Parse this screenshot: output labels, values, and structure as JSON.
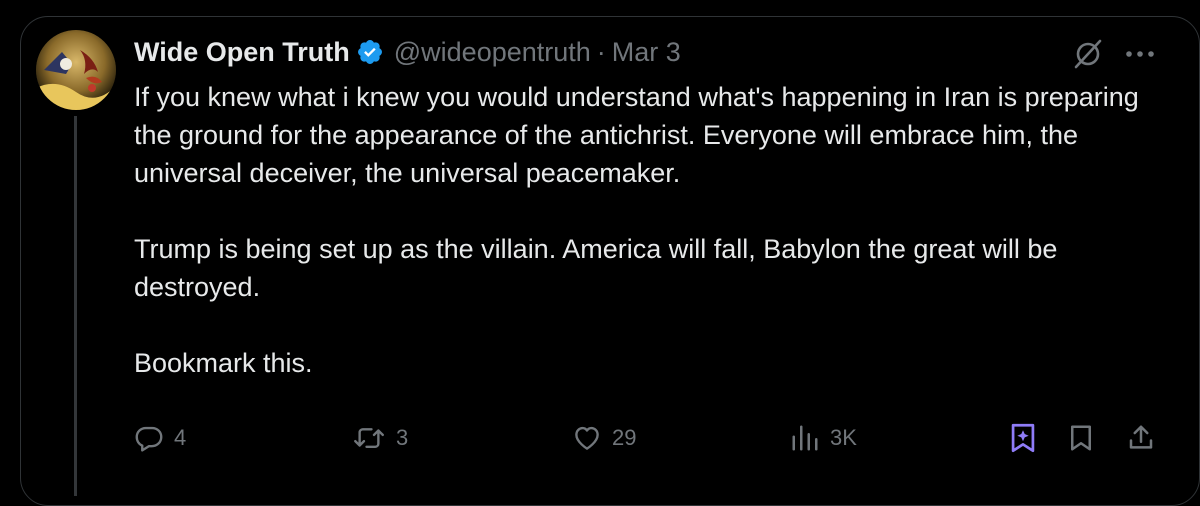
{
  "tweet": {
    "author_name": "Wide Open Truth",
    "handle": "@wideopentruth",
    "separator": "·",
    "date": "Mar 3",
    "paragraphs": [
      "If you knew what i knew you would understand what's happening in Iran is preparing the ground for the appearance of the antichrist. Everyone will embrace him, the universal deceiver, the universal peacemaker.",
      "Trump is being set up as the villain. America will fall, Babylon the great will be destroyed.",
      "Bookmark this."
    ]
  },
  "actions": {
    "replies": "4",
    "reposts": "3",
    "likes": "29",
    "views": "3K"
  },
  "icons": {
    "verified": "verified-badge-icon",
    "grok": "grok-icon",
    "more": "more-icon",
    "reply": "reply-icon",
    "repost": "repost-icon",
    "like": "like-icon",
    "views": "views-icon",
    "grok_explain": "grok-explain-icon",
    "bookmark": "bookmark-icon",
    "share": "share-icon"
  },
  "colors": {
    "background": "#000000",
    "text": "#e7e9ea",
    "muted": "#71767b",
    "verified": "#1d9bf0",
    "accent_purple": "#8f7cf8"
  }
}
